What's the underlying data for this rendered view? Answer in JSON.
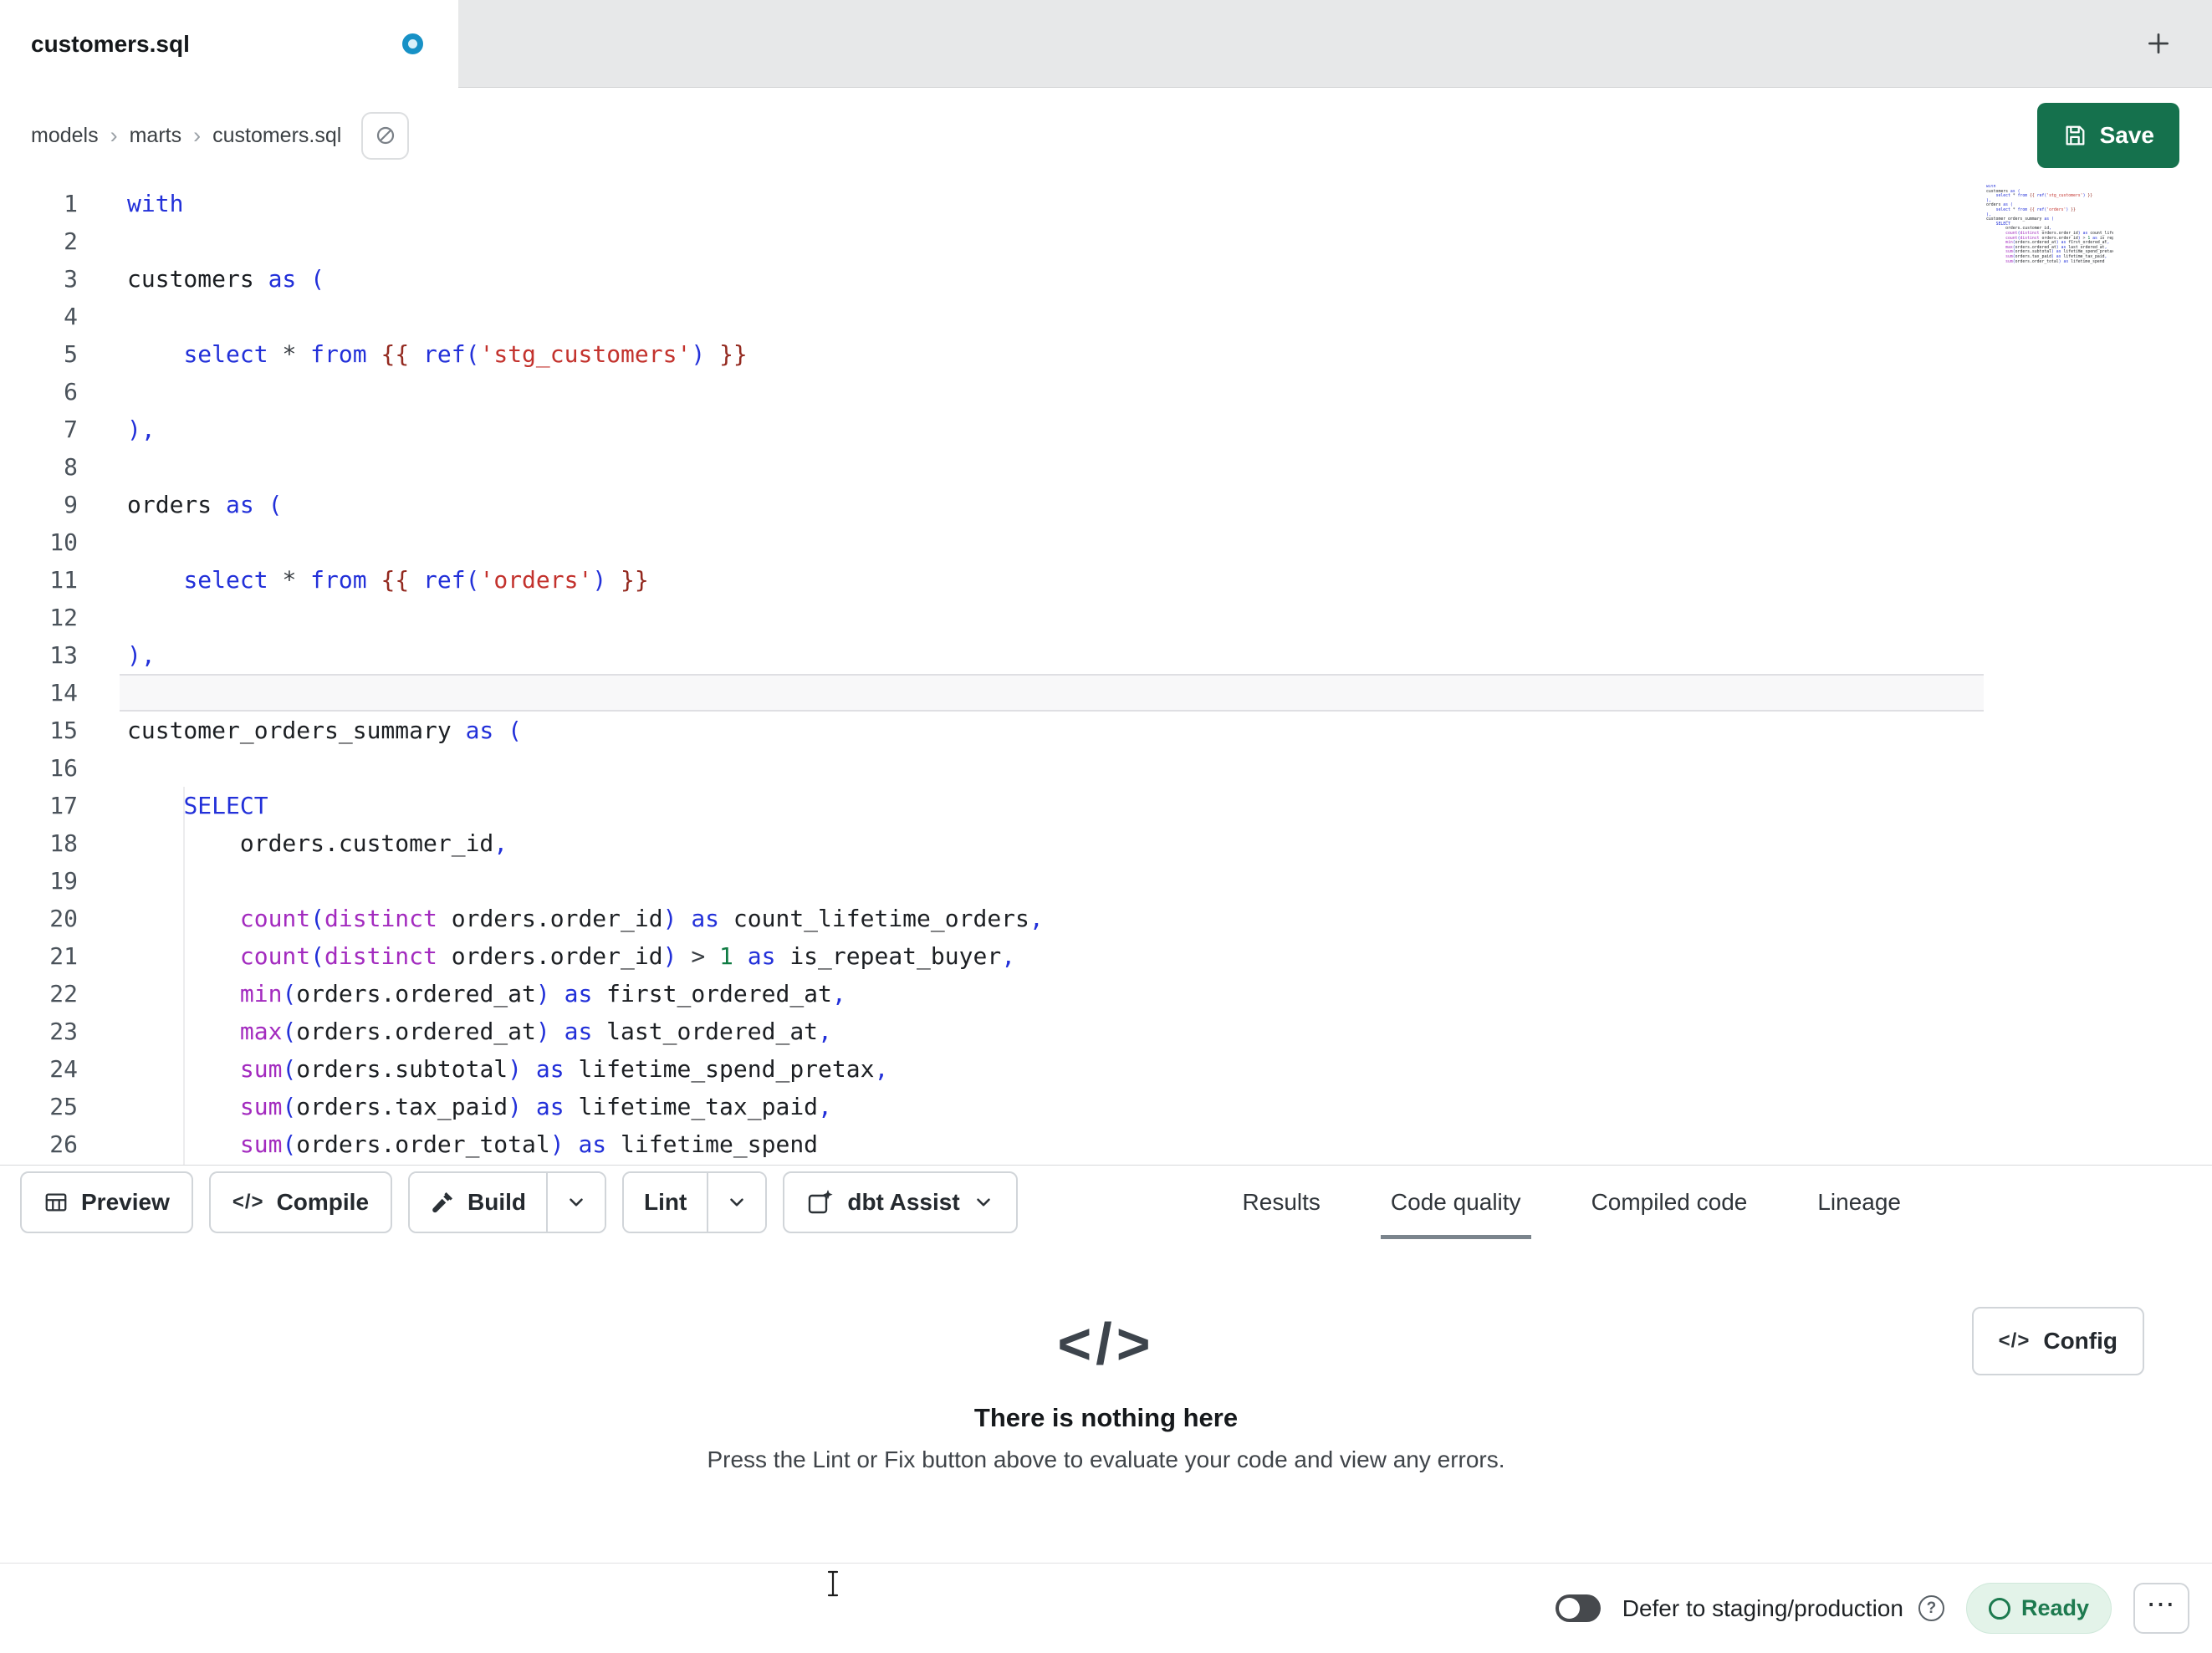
{
  "tab_bar": {
    "active_tab": "customers.sql",
    "unsaved_indicator": true
  },
  "breadcrumb": {
    "items": [
      "models",
      "marts",
      "customers.sql"
    ],
    "separator": "›"
  },
  "header": {
    "save_label": "Save"
  },
  "editor": {
    "active_line": 14,
    "lines": [
      [
        [
          "kw",
          "with"
        ]
      ],
      [],
      [
        [
          "id",
          "customers "
        ],
        [
          "kw",
          "as"
        ],
        [
          "id",
          " "
        ],
        [
          "pn",
          "("
        ]
      ],
      [],
      [
        [
          "id",
          "    "
        ],
        [
          "kw",
          "select"
        ],
        [
          "id",
          " "
        ],
        [
          "op",
          "*"
        ],
        [
          "id",
          " "
        ],
        [
          "kw",
          "from"
        ],
        [
          "id",
          " "
        ],
        [
          "jj",
          "{{ "
        ],
        [
          "kw",
          "ref"
        ],
        [
          "pn",
          "("
        ],
        [
          "str",
          "'stg_customers'"
        ],
        [
          "pn",
          ")"
        ],
        [
          "jj",
          " }}"
        ]
      ],
      [],
      [
        [
          "pn",
          "),"
        ]
      ],
      [],
      [
        [
          "id",
          "orders "
        ],
        [
          "kw",
          "as"
        ],
        [
          "id",
          " "
        ],
        [
          "pn",
          "("
        ]
      ],
      [],
      [
        [
          "id",
          "    "
        ],
        [
          "kw",
          "select"
        ],
        [
          "id",
          " "
        ],
        [
          "op",
          "*"
        ],
        [
          "id",
          " "
        ],
        [
          "kw",
          "from"
        ],
        [
          "id",
          " "
        ],
        [
          "jj",
          "{{ "
        ],
        [
          "kw",
          "ref"
        ],
        [
          "pn",
          "("
        ],
        [
          "str",
          "'orders'"
        ],
        [
          "pn",
          ")"
        ],
        [
          "jj",
          " }}"
        ]
      ],
      [],
      [
        [
          "pn",
          "),"
        ]
      ],
      [],
      [
        [
          "id",
          "customer_orders_summary "
        ],
        [
          "kw",
          "as"
        ],
        [
          "id",
          " "
        ],
        [
          "pn",
          "("
        ]
      ],
      [],
      [
        [
          "id",
          "    "
        ],
        [
          "kw",
          "SELECT"
        ]
      ],
      [
        [
          "id",
          "        orders.customer_id"
        ],
        [
          "pn",
          ","
        ]
      ],
      [],
      [
        [
          "id",
          "        "
        ],
        [
          "fn",
          "count"
        ],
        [
          "pn",
          "("
        ],
        [
          "fn",
          "distinct"
        ],
        [
          "id",
          " orders.order_id"
        ],
        [
          "pn",
          ")"
        ],
        [
          "id",
          " "
        ],
        [
          "kw",
          "as"
        ],
        [
          "id",
          " count_lifetime_orders"
        ],
        [
          "pn",
          ","
        ]
      ],
      [
        [
          "id",
          "        "
        ],
        [
          "fn",
          "count"
        ],
        [
          "pn",
          "("
        ],
        [
          "fn",
          "distinct"
        ],
        [
          "id",
          " orders.order_id"
        ],
        [
          "pn",
          ")"
        ],
        [
          "id",
          " "
        ],
        [
          "op",
          ">"
        ],
        [
          "id",
          " "
        ],
        [
          "num",
          "1"
        ],
        [
          "id",
          " "
        ],
        [
          "kw",
          "as"
        ],
        [
          "id",
          " is_repeat_buyer"
        ],
        [
          "pn",
          ","
        ]
      ],
      [
        [
          "id",
          "        "
        ],
        [
          "fn",
          "min"
        ],
        [
          "pn",
          "("
        ],
        [
          "id",
          "orders.ordered_at"
        ],
        [
          "pn",
          ")"
        ],
        [
          "id",
          " "
        ],
        [
          "kw",
          "as"
        ],
        [
          "id",
          " first_ordered_at"
        ],
        [
          "pn",
          ","
        ]
      ],
      [
        [
          "id",
          "        "
        ],
        [
          "fn",
          "max"
        ],
        [
          "pn",
          "("
        ],
        [
          "id",
          "orders.ordered_at"
        ],
        [
          "pn",
          ")"
        ],
        [
          "id",
          " "
        ],
        [
          "kw",
          "as"
        ],
        [
          "id",
          " last_ordered_at"
        ],
        [
          "pn",
          ","
        ]
      ],
      [
        [
          "id",
          "        "
        ],
        [
          "fn",
          "sum"
        ],
        [
          "pn",
          "("
        ],
        [
          "id",
          "orders.subtotal"
        ],
        [
          "pn",
          ")"
        ],
        [
          "id",
          " "
        ],
        [
          "kw",
          "as"
        ],
        [
          "id",
          " lifetime_spend_pretax"
        ],
        [
          "pn",
          ","
        ]
      ],
      [
        [
          "id",
          "        "
        ],
        [
          "fn",
          "sum"
        ],
        [
          "pn",
          "("
        ],
        [
          "id",
          "orders.tax_paid"
        ],
        [
          "pn",
          ")"
        ],
        [
          "id",
          " "
        ],
        [
          "kw",
          "as"
        ],
        [
          "id",
          " lifetime_tax_paid"
        ],
        [
          "pn",
          ","
        ]
      ],
      [
        [
          "id",
          "        "
        ],
        [
          "fn",
          "sum"
        ],
        [
          "pn",
          "("
        ],
        [
          "id",
          "orders.order_total"
        ],
        [
          "pn",
          ")"
        ],
        [
          "id",
          " "
        ],
        [
          "kw",
          "as"
        ],
        [
          "id",
          " lifetime_spend"
        ]
      ]
    ]
  },
  "toolbar": {
    "preview_label": "Preview",
    "compile_label": "Compile",
    "build_label": "Build",
    "lint_label": "Lint",
    "assist_label": "dbt Assist",
    "compile_glyph": "</>"
  },
  "panel": {
    "tabs": [
      {
        "label": "Results",
        "active": false
      },
      {
        "label": "Code quality",
        "active": true
      },
      {
        "label": "Compiled code",
        "active": false
      },
      {
        "label": "Lineage",
        "active": false
      }
    ]
  },
  "empty_state": {
    "icon_glyph": "</>",
    "title": "There is nothing here",
    "subtitle": "Press the Lint or Fix button above to evaluate your code and view any errors.",
    "config_label": "Config",
    "config_glyph": "</>"
  },
  "status_bar": {
    "defer_label": "Defer to staging/production",
    "defer_on": false,
    "help_label": "?",
    "ready_label": "Ready",
    "overflow_label": "⋯"
  },
  "icons": [
    "unsaved-dot-icon",
    "plus-icon",
    "circle-slash-icon",
    "floppy-icon",
    "table-icon",
    "code-icon",
    "hammer-icon",
    "chevron-down-icon",
    "sparkle-square-icon",
    "question-circle-icon",
    "status-ring-icon",
    "ellipsis-icon",
    "text-cursor"
  ],
  "colors": {
    "accent-green": "#15714d",
    "tab-dot": "#1791c6",
    "tab-underline": "#7b858d",
    "ready-bg": "#e3f3e9",
    "ready-text": "#1d7a4f",
    "gutter": "#4b535b",
    "tk-kw": "#2230d9",
    "tk-fn": "#a32bbf",
    "tk-str": "#c3322d",
    "tk-jj": "#93291f",
    "tk-num": "#0f7b43",
    "tk-op": "#3a3f44",
    "tk-id": "#1c1f23",
    "tk-pn": "#2230d9"
  }
}
